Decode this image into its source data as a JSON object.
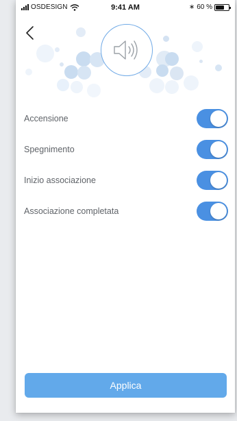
{
  "status_bar": {
    "carrier": "OSDESIGN",
    "time": "9:41 AM",
    "battery_label": "60 %",
    "battery_level": 0.6,
    "icons": [
      "signal-icon",
      "wifi-icon",
      "bluetooth-icon",
      "battery-icon"
    ]
  },
  "header": {
    "back_icon": "chevron-left-icon",
    "hero_icon": "speaker-icon"
  },
  "settings": [
    {
      "label": "Accensione",
      "enabled": true
    },
    {
      "label": "Spegnimento",
      "enabled": true
    },
    {
      "label": "Inizio associazione",
      "enabled": true
    },
    {
      "label": "Associazione completata",
      "enabled": true
    }
  ],
  "apply_button": {
    "label": "Applica"
  },
  "colors": {
    "accent": "#4a90e2",
    "button": "#62a9ea",
    "bubble_light": "#e8f1fb",
    "bubble_mid": "#c9dcf0",
    "text": "#5f6368"
  }
}
